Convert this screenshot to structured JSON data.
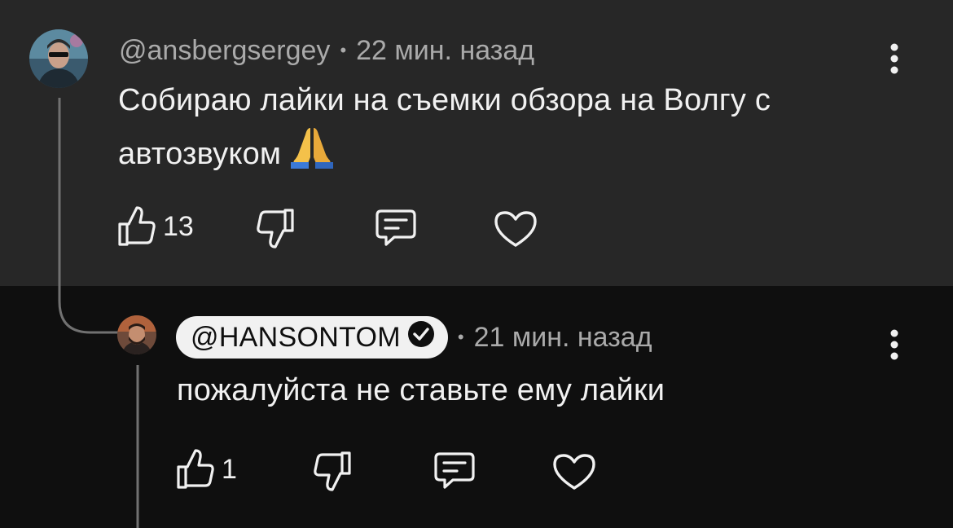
{
  "comments": [
    {
      "username": "@ansbergsergey",
      "time": "22 мин. назад",
      "text_line1": "Собираю лайки на съемки обзора на Волгу с",
      "text_line2": "автозвуком",
      "emoji": "🙏",
      "likes": "13"
    },
    {
      "username": "@HANSONTOM",
      "verified": true,
      "time": "21 мин. назад",
      "text": "пожалуйста не ставьте ему лайки",
      "likes": "1"
    }
  ],
  "separator": "•",
  "icons": {
    "like": "thumb-up-icon",
    "dislike": "thumb-down-icon",
    "reply": "comment-icon",
    "heart": "heart-icon",
    "more": "more-vertical-icon",
    "verified": "verified-check-icon"
  },
  "colors": {
    "top_background": "#272727",
    "reply_background": "#0f0f0f",
    "text": "#f1f1f1",
    "secondary_text": "#aaaaaa",
    "creator_pill": "#f1f1f1"
  }
}
